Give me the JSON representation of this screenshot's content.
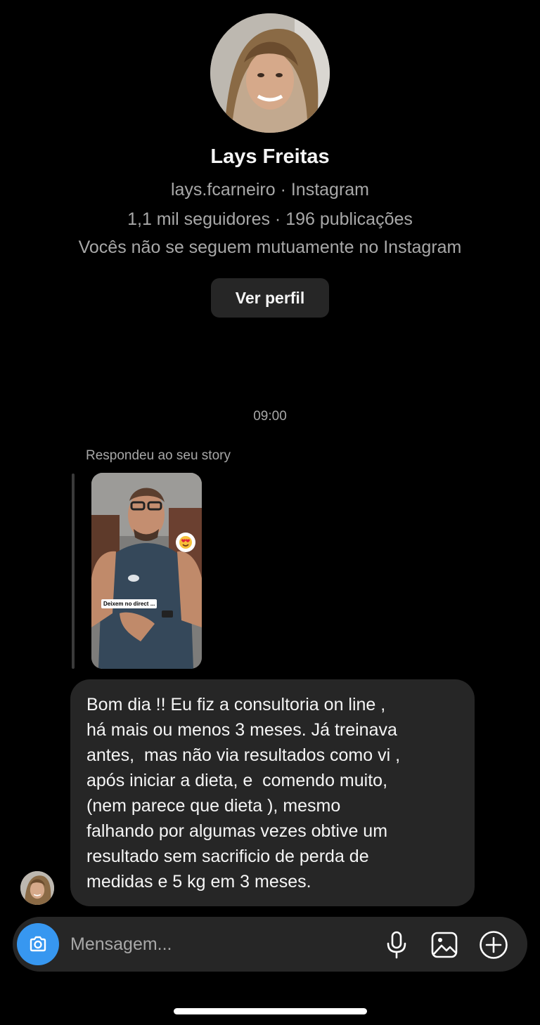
{
  "profile": {
    "name": "Lays Freitas",
    "username_line": "lays.fcarneiro · Instagram",
    "stats_line": "1,1 mil seguidores · 196 publicações",
    "mutual_line": "Vocês não se seguem mutuamente no Instagram",
    "view_profile_label": "Ver perfil"
  },
  "conversation": {
    "timestamp": "09:00",
    "reply_label": "Respondeu ao seu story",
    "story": {
      "caption": "Deixem no direct ...",
      "sticker_icon": "heart-eyes-emoji-icon"
    },
    "message": "Bom dia !! Eu fiz a consultoria on line ,\nhá mais ou menos 3 meses. Já treinava\nantes,  mas não via resultados como vi ,\napós iniciar a dieta, e  comendo muito,\n(nem parece que dieta ), mesmo\nfalhando por algumas vezes obtive um\nresultado sem sacrificio de perda de\nmedidas e 5 kg em 3 meses."
  },
  "composer": {
    "placeholder": "Mensagem...",
    "value": "",
    "icons": [
      "camera-icon",
      "microphone-icon",
      "gallery-icon",
      "add-icon"
    ]
  },
  "colors": {
    "background": "#000000",
    "bubble": "#262626",
    "secondary_text": "#a8a8a8",
    "accent": "#3797f0"
  }
}
